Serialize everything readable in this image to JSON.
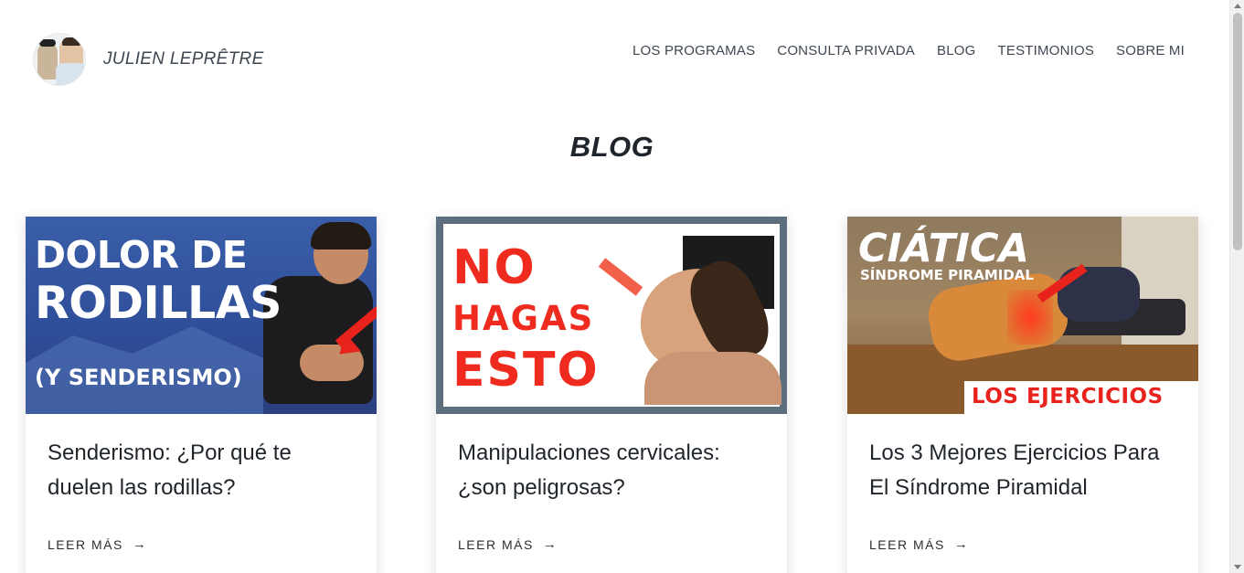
{
  "header": {
    "site_title": "JULIEN LEPRÊTRE",
    "nav": [
      {
        "label": "LOS PROGRAMAS"
      },
      {
        "label": "CONSULTA PRIVADA"
      },
      {
        "label": "BLOG"
      },
      {
        "label": "TESTIMONIOS"
      },
      {
        "label": "SOBRE MI"
      }
    ]
  },
  "page_title": "BLOG",
  "cards": [
    {
      "title": "Senderismo: ¿Por qué te duelen las rodillas?",
      "read_more": "LEER MÁS",
      "thumb_lines": [
        "DOLOR DE",
        "RODILLAS",
        "(Y SENDERISMO)"
      ]
    },
    {
      "title": "Manipulaciones cervicales: ¿son peligrosas?",
      "read_more": "LEER MÁS",
      "thumb_lines": [
        "NO",
        "HAGAS",
        "ESTO"
      ]
    },
    {
      "title": "Los 3 Mejores Ejercicios Para El Síndrome Piramidal",
      "read_more": "LEER MÁS",
      "thumb_lines": [
        "CIÁTICA",
        "SÍNDROME PIRAMIDAL",
        "LOS EJERCICIOS"
      ]
    }
  ],
  "icons": {
    "read_more_arrow": "→"
  }
}
